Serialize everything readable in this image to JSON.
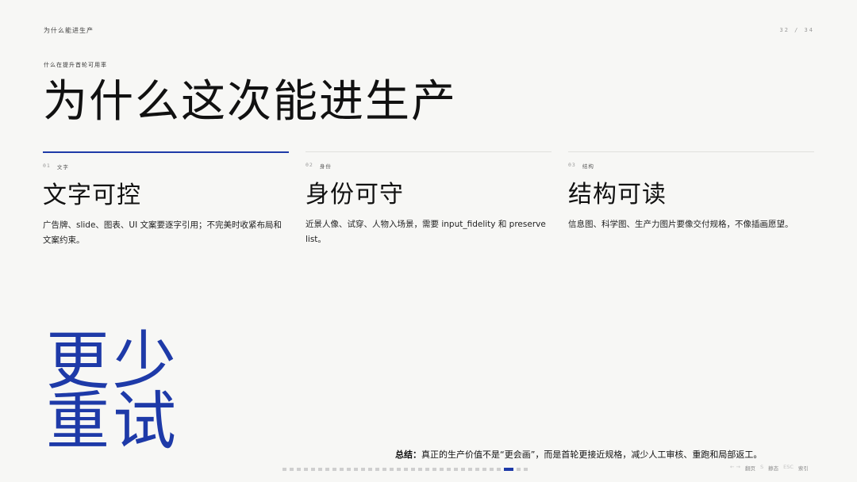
{
  "header": {
    "section": "为什么能进生产",
    "page_indicator": "32 / 34"
  },
  "kicker": "什么在提升首轮可用率",
  "title": "为什么这次能进生产",
  "columns": [
    {
      "index": "01",
      "tag": "文字",
      "title": "文字可控",
      "desc": "广告牌、slide、图表、UI 文案要逐字引用；不完美时收紧布局和文案约束。"
    },
    {
      "index": "02",
      "tag": "身份",
      "title": "身份可守",
      "desc": "近景人像、试穿、人物入场景，需要 input_fidelity 和 preserve list。"
    },
    {
      "index": "03",
      "tag": "结构",
      "title": "结构可读",
      "desc": "信息图、科学图、生产力图片要像交付规格，不像插画愿望。"
    }
  ],
  "big_word": "更少重试",
  "summary": {
    "label": "总结：",
    "text": "真正的生产价值不是“更会画”，而是首轮更接近规格，减少人工审核、重跑和局部返工。"
  },
  "pager": {
    "total": 34,
    "current": 32
  },
  "hints": {
    "nav_key": "← →",
    "nav_label": "翻页",
    "static_key": "S",
    "static_label": "静态",
    "index_key": "ESC",
    "index_label": "索引"
  },
  "colors": {
    "accent": "#1e3aa8",
    "background": "#f7f7f5"
  }
}
